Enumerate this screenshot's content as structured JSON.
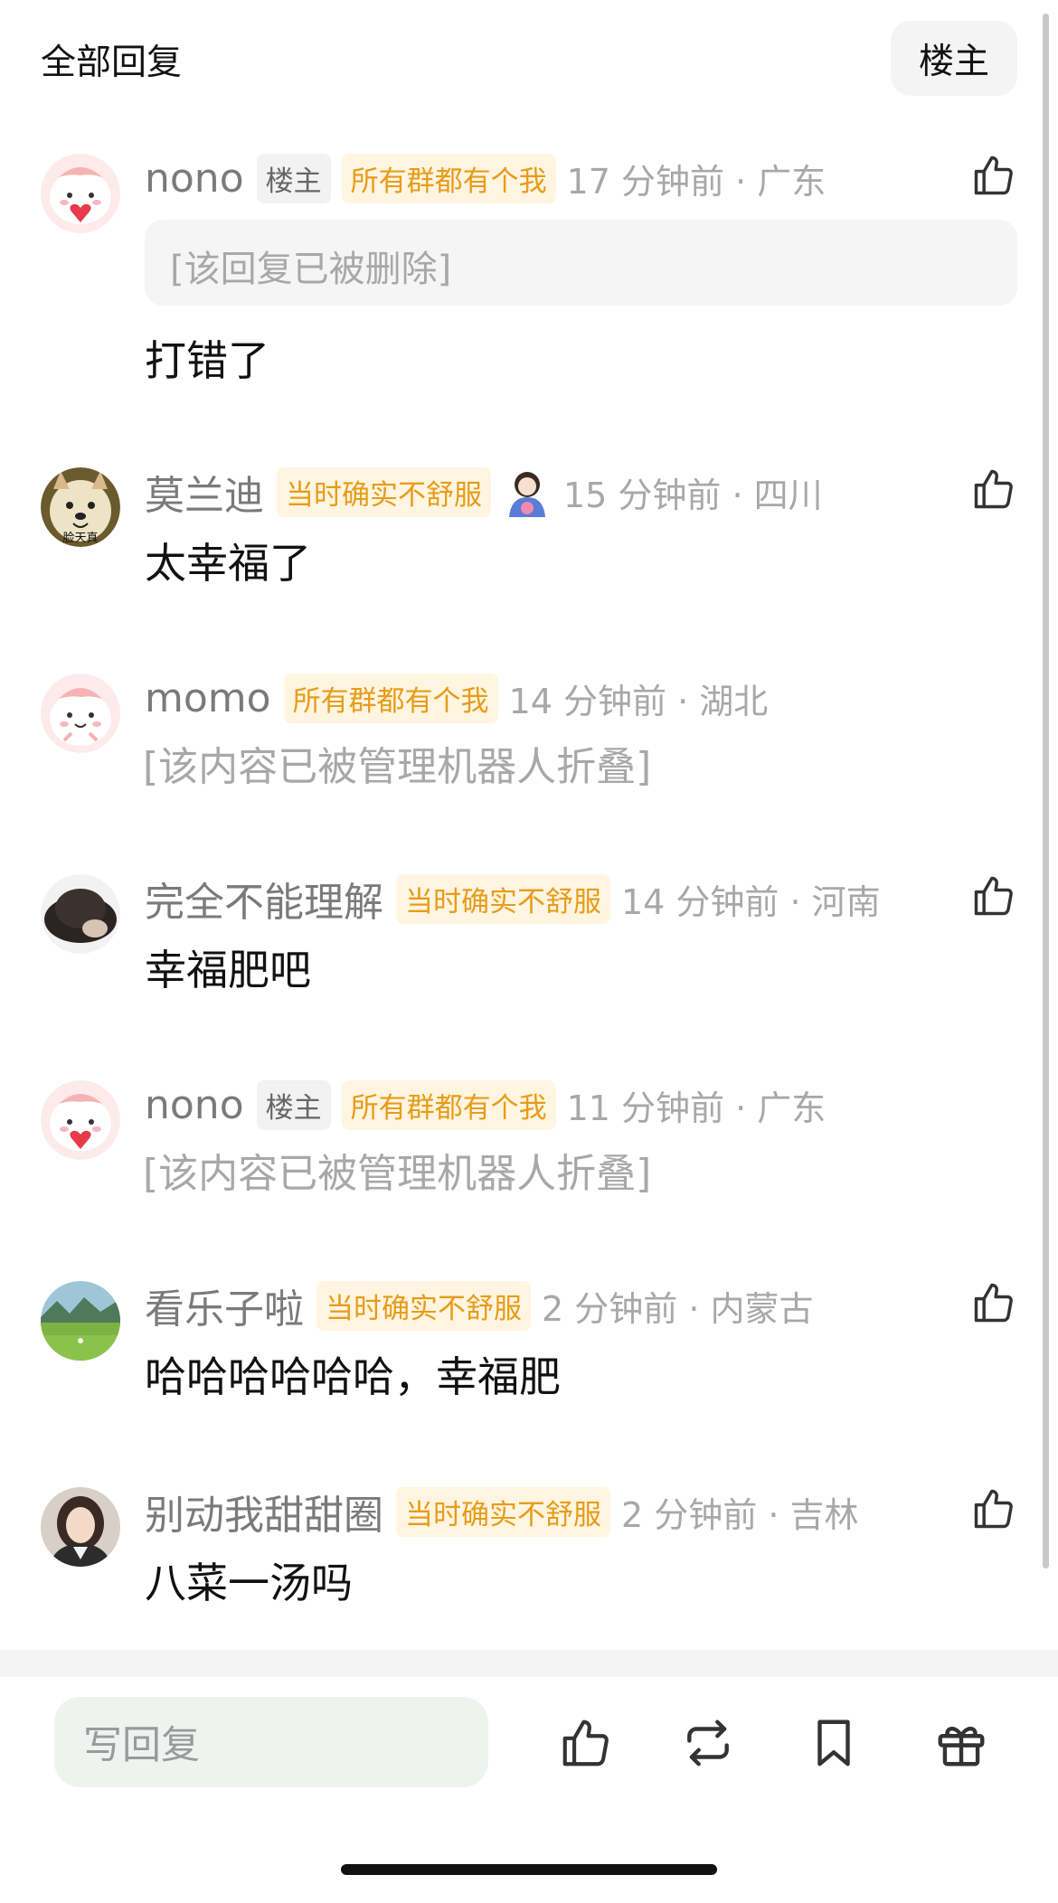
{
  "header": {
    "title": "全部回复",
    "owner_button": "楼主"
  },
  "comments": [
    {
      "username": "nono",
      "owner_badge": "楼主",
      "group_badge": "所有群都有个我",
      "time_location": "17 分钟前 · 广东",
      "deleted_reply": "[该回复已被删除]",
      "text": "打错了",
      "avatar": "pink-bunny-heart-avatar",
      "has_like": true
    },
    {
      "username": "莫兰迪",
      "group_badge": "当时确实不舒服",
      "time_location": "15 分钟前 · 四川",
      "text": "太幸福了",
      "avatar": "shiba-dog-avatar",
      "avatar_caption": "脸天真",
      "has_like": true
    },
    {
      "username": "momo",
      "group_badge": "所有群都有个我",
      "time_location": "14 分钟前 · 湖北",
      "folded_text": "[该内容已被管理机器人折叠]",
      "avatar": "pink-bunny-avatar",
      "has_like": false
    },
    {
      "username": "完全不能理解",
      "group_badge": "当时确实不舒服",
      "time_location": "14 分钟前 · 河南",
      "text": "幸福肥吧",
      "avatar": "dark-hair-avatar",
      "has_like": true
    },
    {
      "username": "nono",
      "owner_badge": "楼主",
      "group_badge": "所有群都有个我",
      "time_location": "11 分钟前 · 广东",
      "folded_text": "[该内容已被管理机器人折叠]",
      "avatar": "pink-bunny-heart-avatar",
      "has_like": false
    },
    {
      "username": "看乐子啦",
      "group_badge": "当时确实不舒服",
      "time_location": "2 分钟前 · 内蒙古",
      "text": "哈哈哈哈哈哈，幸福肥",
      "avatar": "green-field-avatar",
      "has_like": true
    },
    {
      "username": "别动我甜甜圈",
      "group_badge": "当时确实不舒服",
      "time_location": "2 分钟前 · 吉林",
      "text": "八菜一汤吗",
      "avatar": "woman-portrait-avatar",
      "has_like": true
    }
  ],
  "bottom_bar": {
    "reply_placeholder": "写回复",
    "icons": [
      "thumbs-up-icon",
      "repost-icon",
      "bookmark-icon",
      "gift-icon"
    ]
  },
  "colors": {
    "badge_text": "#e89c1a",
    "badge_bg": "#fff5e0",
    "muted": "#a8a8a8"
  }
}
